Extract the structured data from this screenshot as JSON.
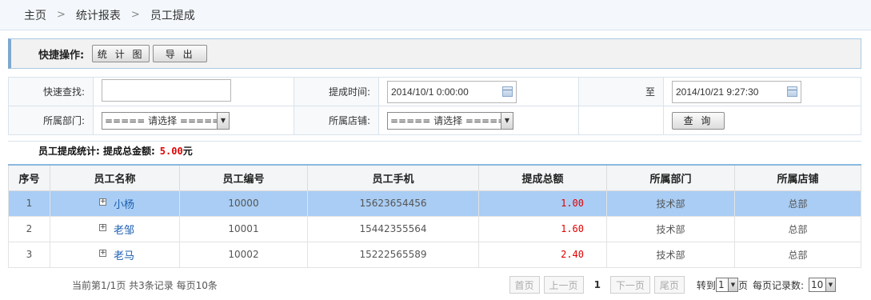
{
  "breadcrumb": [
    "主页",
    "统计报表",
    "员工提成"
  ],
  "quickbar": {
    "title": "快捷操作:",
    "buttons": [
      "统 计 图",
      "导  出"
    ]
  },
  "search": {
    "quick_label": "快速查找:",
    "quick_value": "",
    "time_label": "提成时间:",
    "time_from": "2014/10/1 0:00:00",
    "to_label": "至",
    "time_to": "2014/10/21 9:27:30",
    "dept_label": "所属部门:",
    "dept_value": "===== 请选择 =====",
    "store_label": "所属店铺:",
    "store_value": "===== 请选择 =====",
    "query_button": "查  询"
  },
  "summary": {
    "label": "员工提成统计: 提成总金额:",
    "amount": "5.00",
    "unit": "元"
  },
  "table": {
    "headers": [
      "序号",
      "员工名称",
      "员工编号",
      "员工手机",
      "提成总额",
      "所属部门",
      "所属店铺"
    ],
    "rows": [
      [
        "1",
        "小杨",
        "10000",
        "15623654456",
        "1.00",
        "技术部",
        "总部"
      ],
      [
        "2",
        "老邹",
        "10001",
        "15442355564",
        "1.60",
        "技术部",
        "总部"
      ],
      [
        "3",
        "老马",
        "10002",
        "15222565589",
        "2.40",
        "技术部",
        "总部"
      ]
    ]
  },
  "pager": {
    "info": "当前第1/1页 共3条记录 每页10条",
    "first": "首页",
    "prev": "上一页",
    "current": "1",
    "next": "下一页",
    "last": "尾页",
    "goto_label": "转到",
    "goto_value": "1",
    "page_suffix": "页",
    "per_page_label": "每页记录数:",
    "per_page_value": "10"
  },
  "colors": {
    "selected_row": "#a9cdf4",
    "money": "#e00000",
    "name_link": "#1c5fb0"
  }
}
